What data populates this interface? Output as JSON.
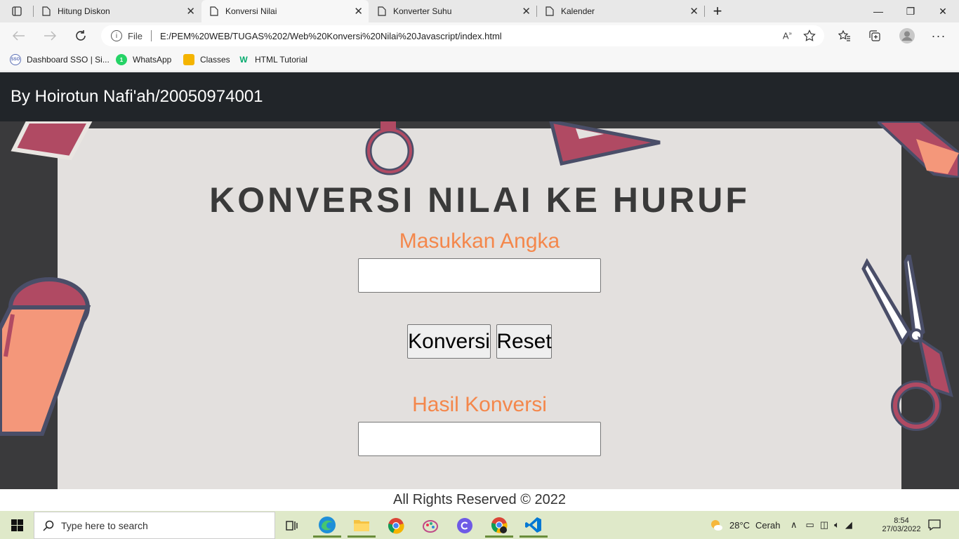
{
  "tabs": [
    {
      "title": "Hitung Diskon",
      "active": false
    },
    {
      "title": "Konversi Nilai",
      "active": true
    },
    {
      "title": "Konverter Suhu",
      "active": false
    },
    {
      "title": "Kalender",
      "active": false
    }
  ],
  "tab_close_glyph": "✕",
  "new_tab_glyph": "+",
  "window_controls": {
    "minimize": "—",
    "restore": "❐",
    "close": "✕"
  },
  "address": {
    "scheme_label": "File",
    "url": "E:/PEM%20WEB/TUGAS%202/Web%20Konversi%20Nilai%20Javascript/index.html"
  },
  "bookmarks": [
    {
      "label": "Dashboard SSO | Si...",
      "icon": "sso-icon",
      "color": "#5b6fb5"
    },
    {
      "label": "WhatsApp",
      "icon": "whatsapp-icon",
      "color": "#25d366"
    },
    {
      "label": "Classes",
      "icon": "classroom-icon",
      "color": "#f4b400"
    },
    {
      "label": "HTML Tutorial",
      "icon": "w3schools-icon",
      "color": "#04aa6d"
    }
  ],
  "page": {
    "header": "By Hoirotun Nafi'ah/20050974001",
    "title": "KONVERSI NILAI KE HURUF",
    "input_label": "Masukkan Angka",
    "input_value": "",
    "convert_button": "Konversi",
    "reset_button": "Reset",
    "result_label": "Hasil Konversi",
    "result_value": "",
    "footer": "All Rights Reserved © 2022"
  },
  "taskbar": {
    "search_placeholder": "Type here to search",
    "weather_temp": "28°C",
    "weather_text": "Cerah",
    "time": "8:54",
    "date": "27/03/2022"
  },
  "colors": {
    "header_bg": "#212529",
    "accent_label": "#f4874b",
    "paper": "#e3e0de",
    "board": "#3a3a3c",
    "taskbar": "#dfe9c9"
  }
}
